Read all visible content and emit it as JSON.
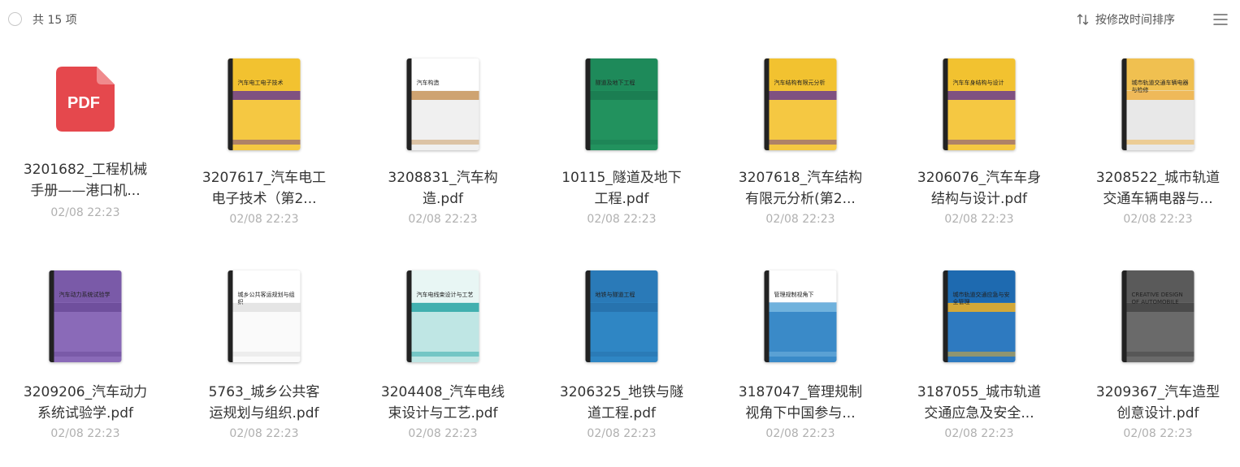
{
  "header": {
    "count_label": "共 15 项",
    "sort_label": "按修改时间排序"
  },
  "files": [
    {
      "line1": "3201682_工程机械",
      "line2": "手册——港口机...",
      "date": "02/08 22:23",
      "type": "pdf-icon"
    },
    {
      "line1": "3207617_汽车电工",
      "line2": "电子技术（第2...",
      "date": "02/08 22:23",
      "type": "cover",
      "cover_title": "汽车电工电子技术",
      "top": "#f2c230",
      "body": "#f5c842",
      "band": "#6a3c8c"
    },
    {
      "line1": "3208831_汽车构",
      "line2": "造.pdf",
      "date": "02/08 22:23",
      "type": "cover",
      "cover_title": "汽车构造",
      "top": "#ffffff",
      "body": "#f0f0f0",
      "band": "#c8955a"
    },
    {
      "line1": "10115_隧道及地下",
      "line2": "工程.pdf",
      "date": "02/08 22:23",
      "type": "cover",
      "cover_title": "隧道及地下工程",
      "top": "#1e8a5a",
      "body": "#22925e",
      "band": "#1a7a50"
    },
    {
      "line1": "3207618_汽车结构",
      "line2": "有限元分析(第2...",
      "date": "02/08 22:23",
      "type": "cover",
      "cover_title": "汽车结构有限元分析",
      "top": "#f2c230",
      "body": "#f5c842",
      "band": "#6a3c8c"
    },
    {
      "line1": "3206076_汽车车身",
      "line2": "结构与设计.pdf",
      "date": "02/08 22:23",
      "type": "cover",
      "cover_title": "汽车车身结构与设计",
      "top": "#f2c230",
      "body": "#f5c842",
      "band": "#6a3c8c"
    },
    {
      "line1": "3208522_城市轨道",
      "line2": "交通车辆电器与...",
      "date": "02/08 22:23",
      "type": "cover",
      "cover_title": "城市轨道交通车辆电器与检修",
      "top": "#f0c050",
      "body": "#e8e8e8",
      "band": "#f0b040"
    },
    {
      "line1": "3209206_汽车动力",
      "line2": "系统试验学.pdf",
      "date": "02/08 22:23",
      "type": "cover",
      "cover_title": "汽车动力系统试验学",
      "top": "#7a5aa8",
      "body": "#8a6ab8",
      "band": "#6a4a98"
    },
    {
      "line1": "5763_城乡公共客",
      "line2": "运规划与组织.pdf",
      "date": "02/08 22:23",
      "type": "cover",
      "cover_title": "城乡公共客运规划与组织",
      "top": "#ffffff",
      "body": "#fafafa",
      "band": "#e0e0e0"
    },
    {
      "line1": "3204408_汽车电线",
      "line2": "束设计与工艺.pdf",
      "date": "02/08 22:23",
      "type": "cover",
      "cover_title": "汽车电线束设计与工艺",
      "top": "#e8f6f4",
      "body": "#bfe6e4",
      "band": "#2aa6a6"
    },
    {
      "line1": "3206325_地铁与隧",
      "line2": "道工程.pdf",
      "date": "02/08 22:23",
      "type": "cover",
      "cover_title": "地铁与隧道工程",
      "top": "#2a7ab8",
      "body": "#2f86c4",
      "band": "#2670aa"
    },
    {
      "line1": "3187047_管理规制",
      "line2": "视角下中国参与...",
      "date": "02/08 22:23",
      "type": "cover",
      "cover_title": "管理规制视角下",
      "top": "#ffffff",
      "body": "#3a8ac8",
      "band": "#7ab8e0"
    },
    {
      "line1": "3187055_城市轨道",
      "line2": "交通应急及安全...",
      "date": "02/08 22:23",
      "type": "cover",
      "cover_title": "城市轨道交通应急与安全管理",
      "top": "#1e6ab0",
      "body": "#2e7ac0",
      "band": "#f0b020"
    },
    {
      "line1": "3209367_汽车造型",
      "line2": "创意设计.pdf",
      "date": "02/08 22:23",
      "type": "cover",
      "cover_title": "CREATIVE DESIGN OF AUTOMOBILE",
      "top": "#5a5a5a",
      "body": "#6a6a6a",
      "band": "#444444"
    }
  ]
}
